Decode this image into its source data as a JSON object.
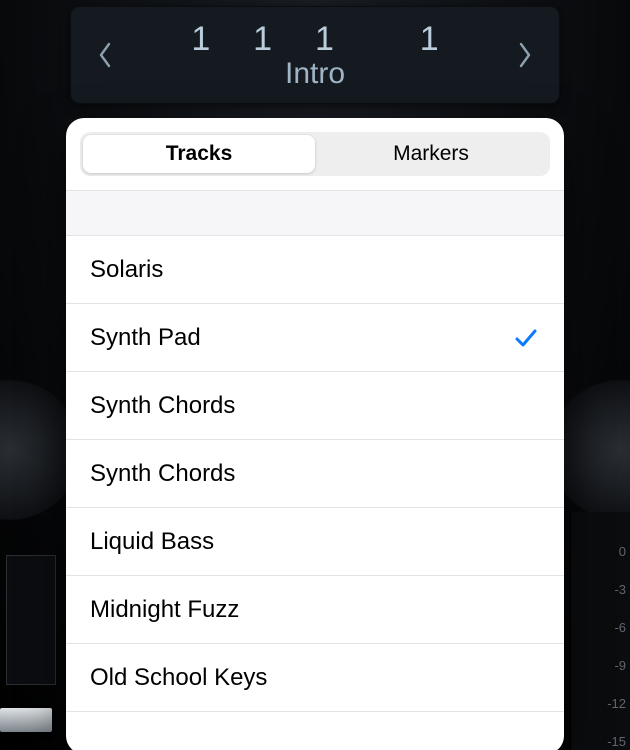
{
  "lcd": {
    "position": {
      "bar": "1",
      "beat": "1",
      "div": "1",
      "tick": "1"
    },
    "marker_name": "Intro"
  },
  "popover": {
    "tabs": {
      "tracks": "Tracks",
      "markers": "Markers",
      "active": "tracks"
    },
    "tracks": [
      {
        "name": "Solaris",
        "selected": false
      },
      {
        "name": "Synth Pad",
        "selected": true
      },
      {
        "name": "Synth Chords",
        "selected": false
      },
      {
        "name": "Synth Chords",
        "selected": false
      },
      {
        "name": "Liquid Bass",
        "selected": false
      },
      {
        "name": "Midnight Fuzz",
        "selected": false
      },
      {
        "name": "Old School Keys",
        "selected": false
      }
    ]
  },
  "meter_ticks": [
    "0",
    "-3",
    "-6",
    "-9",
    "-12",
    "-15"
  ],
  "colors": {
    "accent": "#0a7bff",
    "lcd_text": "#9fb4c4",
    "lcd_bg": "#141a20"
  }
}
